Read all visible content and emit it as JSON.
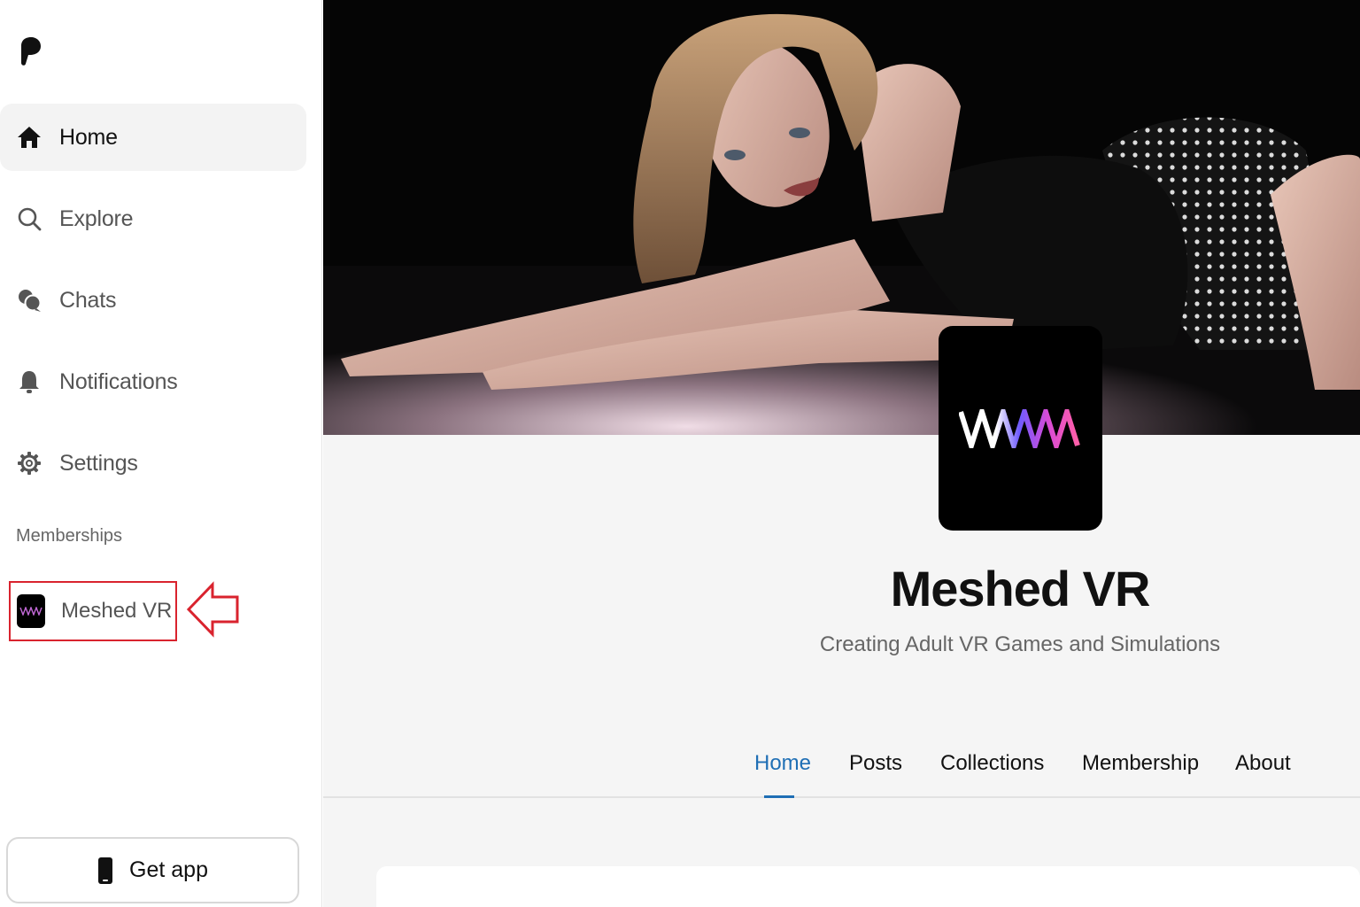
{
  "sidebar": {
    "logo": "patreon-logo",
    "nav": [
      {
        "label": "Home",
        "icon": "home-icon",
        "active": true
      },
      {
        "label": "Explore",
        "icon": "search-icon",
        "active": false
      },
      {
        "label": "Chats",
        "icon": "chat-bubbles-icon",
        "active": false
      },
      {
        "label": "Notifications",
        "icon": "bell-icon",
        "active": false
      },
      {
        "label": "Settings",
        "icon": "gear-icon",
        "active": false
      }
    ],
    "memberships_heading": "Memberships",
    "memberships": [
      {
        "label": "Meshed VR",
        "avatar": "vmm-logo"
      }
    ],
    "get_app": {
      "label": "Get app",
      "icon": "phone-icon"
    }
  },
  "creator": {
    "name": "Meshed VR",
    "tagline": "Creating Adult VR Games and Simulations",
    "avatar": "vmm-logo"
  },
  "tabs": [
    {
      "label": "Home",
      "active": true
    },
    {
      "label": "Posts",
      "active": false
    },
    {
      "label": "Collections",
      "active": false
    },
    {
      "label": "Membership",
      "active": false
    },
    {
      "label": "About",
      "active": false
    }
  ],
  "colors": {
    "accent": "#1f6fb5",
    "highlight": "#d9232e",
    "main_bg": "#f5f5f5"
  }
}
